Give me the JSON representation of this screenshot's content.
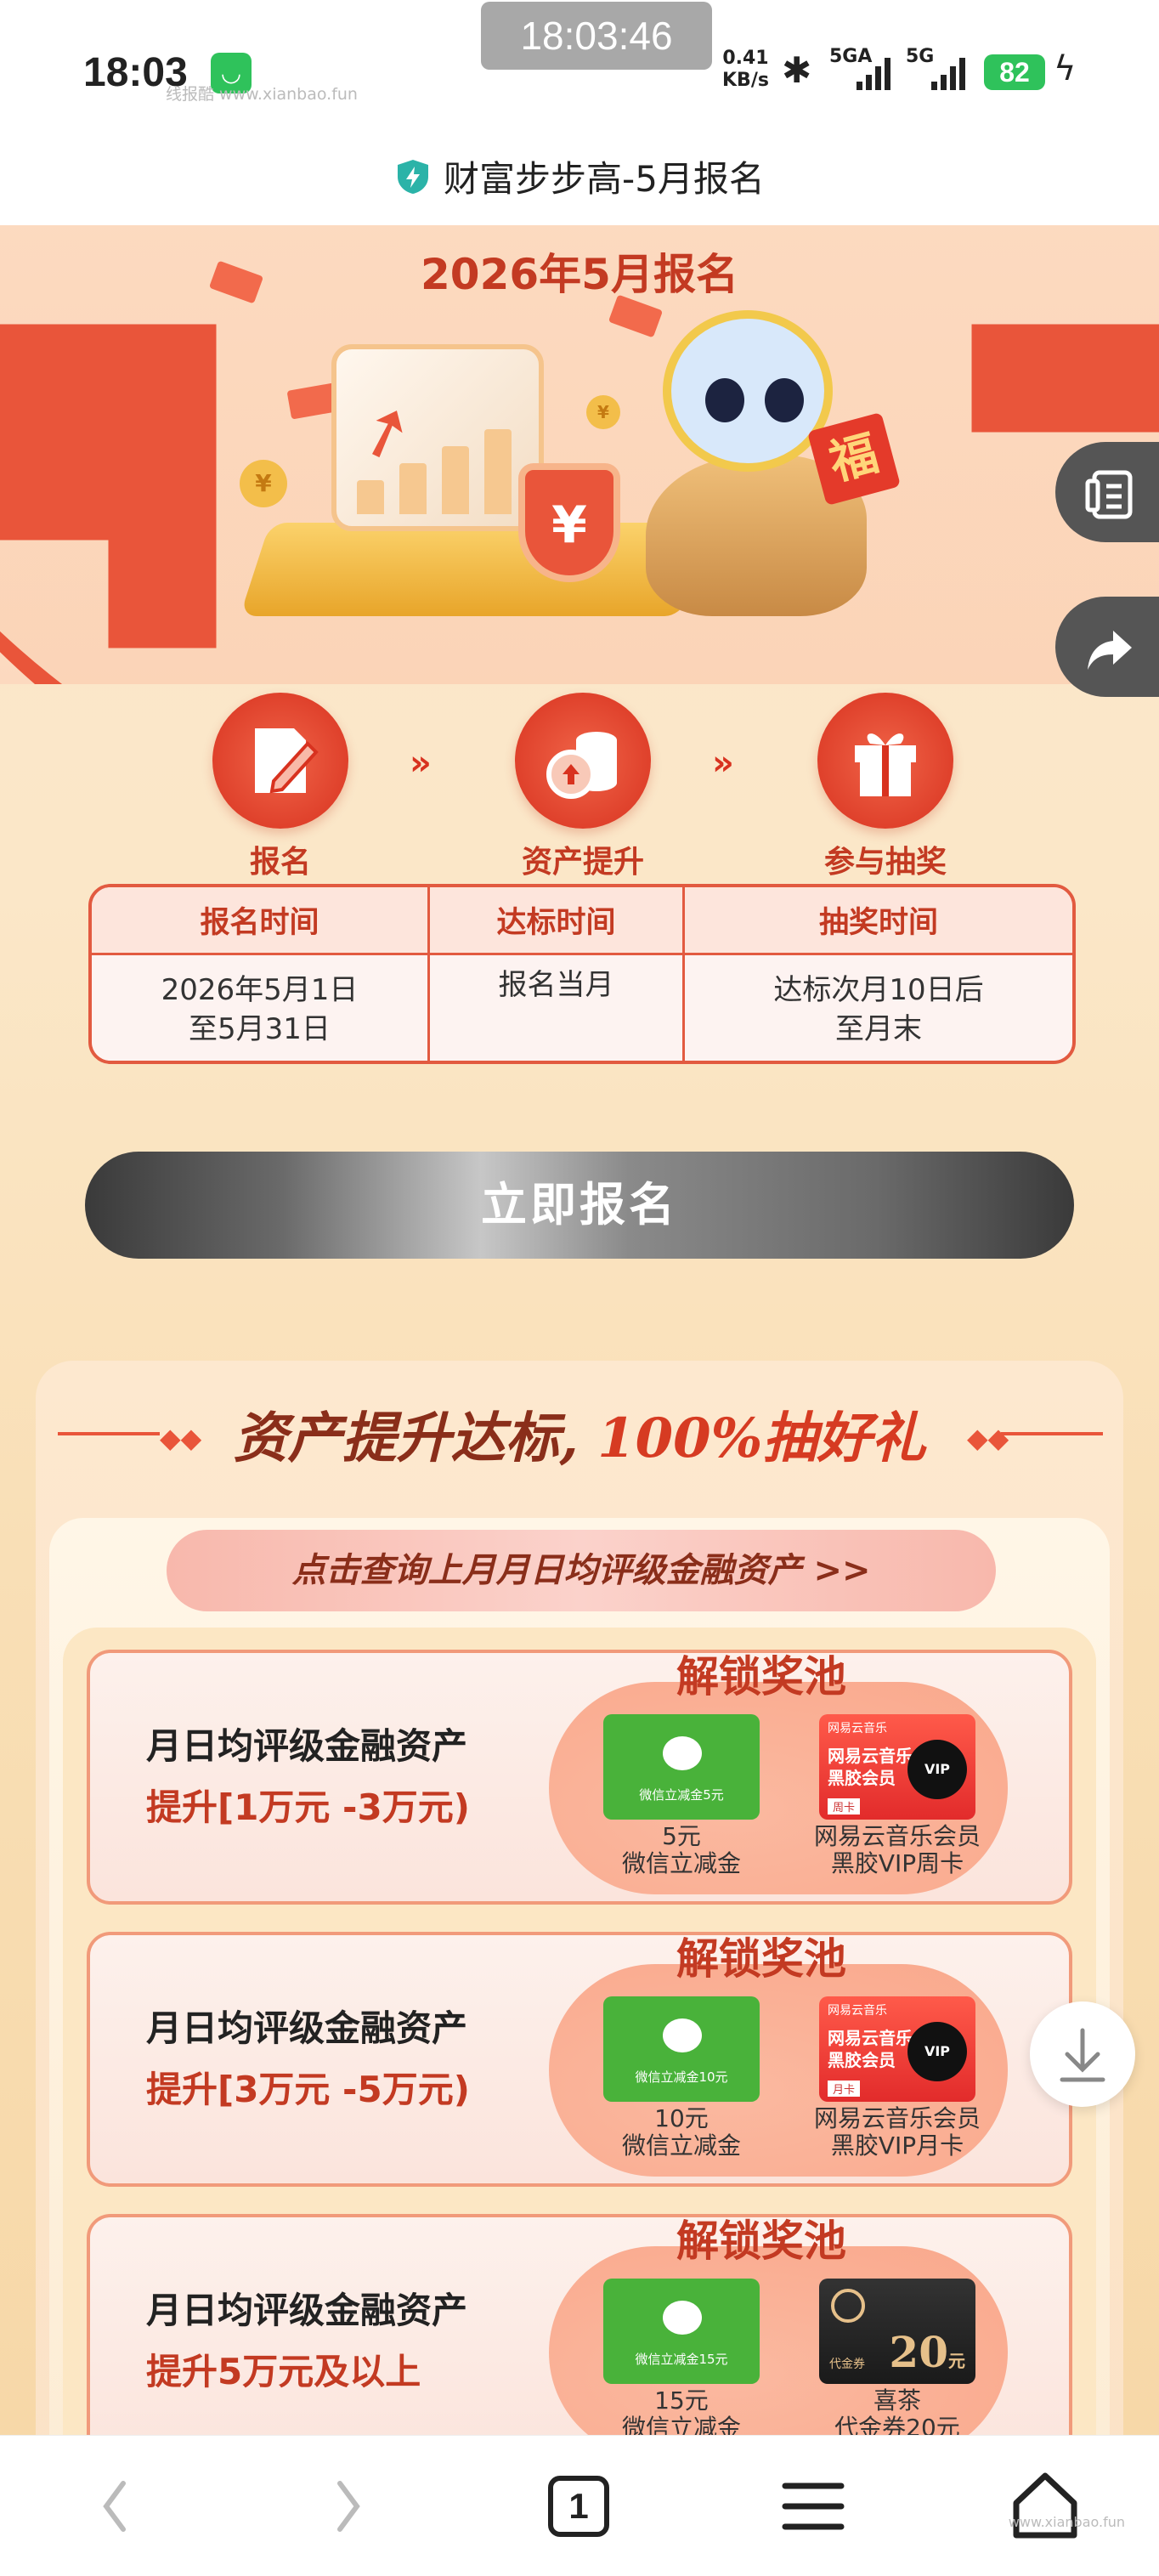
{
  "status_bar": {
    "time": "18:03",
    "clock_overlay": "18:03:46",
    "net_speed_value": "0.41",
    "net_speed_unit": "KB/s",
    "signal1_label": "5GA",
    "signal2_label": "5G",
    "battery": "82",
    "watermark": "线报酷 www.xianbao.fun"
  },
  "title_bar": {
    "title": "财富步步高-5月报名",
    "icon": "shield-lightning-icon"
  },
  "hero": {
    "headline": "2026年5月报名",
    "fu_char": "福",
    "yen_char": "¥"
  },
  "steps": [
    {
      "label": "报名",
      "icon": "edit-icon"
    },
    {
      "label": "资产提升",
      "icon": "coin-stack-icon"
    },
    {
      "label": "参与抽奖",
      "icon": "gift-icon"
    }
  ],
  "step_separator": "»",
  "schedule": {
    "headers": [
      "报名时间",
      "达标时间",
      "抽奖时间"
    ],
    "values": [
      [
        "2026年5月1日",
        "至5月31日"
      ],
      [
        "报名当月"
      ],
      [
        "达标次月10日后",
        "至月末"
      ]
    ]
  },
  "signup_button": "立即报名",
  "rewards": {
    "banner_prefix": "资产提升达标,",
    "banner_highlight": "100%抽好礼",
    "query_link": "点击查询上月月日均评级金融资产 >>",
    "pool_title": "解锁奖池",
    "tiers": [
      {
        "line1": "月日均评级金融资产",
        "line2": "提升[1万元 -3万元)",
        "card1_text": "微信立减金5元",
        "card1_caption": [
          "5元",
          "微信立减金"
        ],
        "card2_header": "网易云音乐",
        "card2_title": [
          "网易云音乐",
          "黑胶会员"
        ],
        "card2_tag": "周卡",
        "card2_caption": [
          "网易云音乐会员",
          "黑胶VIP周卡"
        ]
      },
      {
        "line1": "月日均评级金融资产",
        "line2": "提升[3万元 -5万元)",
        "card1_text": "微信立减金10元",
        "card1_caption": [
          "10元",
          "微信立减金"
        ],
        "card2_header": "网易云音乐",
        "card2_title": [
          "网易云音乐",
          "黑胶会员"
        ],
        "card2_tag": "月卡",
        "card2_caption": [
          "网易云音乐会员",
          "黑胶VIP月卡"
        ]
      },
      {
        "line1": "月日均评级金融资产",
        "line2": "提升5万元及以上",
        "card1_text": "微信立减金15元",
        "card1_caption": [
          "15元",
          "微信立减金"
        ],
        "card2_voucher_label": "代金券",
        "card2_amount": "20",
        "card2_unit": "元",
        "card2_caption": [
          "喜茶",
          "代金券20元"
        ]
      }
    ]
  },
  "floating": {
    "menu": "list-icon",
    "share": "share-icon",
    "download": "download-icon"
  },
  "bottom_nav": {
    "tab_count": "1",
    "watermark": "www.xianbao.fun"
  },
  "colors": {
    "accent_red": "#d8321f",
    "brand_orange": "#e9553a",
    "wechat_green": "#49b23a"
  }
}
